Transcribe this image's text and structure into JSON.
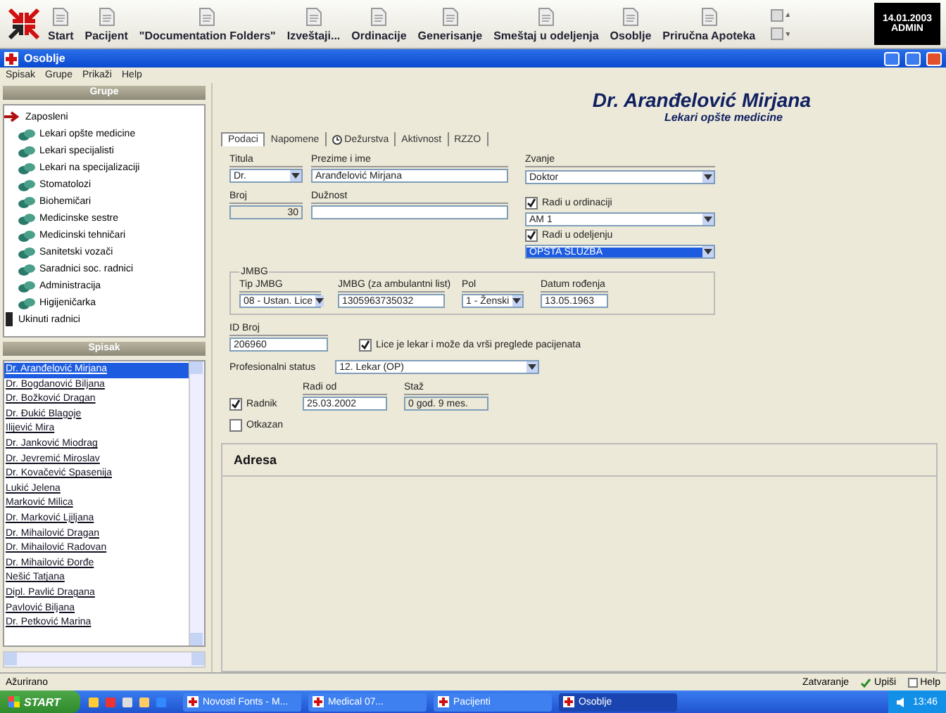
{
  "toolbar": {
    "buttons": [
      {
        "label": "Start"
      },
      {
        "label": "Pacijent"
      },
      {
        "label": "\"Documentation Folders\""
      },
      {
        "label": "Izveštaji..."
      },
      {
        "label": "Ordinacije"
      },
      {
        "label": "Generisanje"
      },
      {
        "label": "Smeštaj u odeljenja"
      },
      {
        "label": "Osoblje"
      },
      {
        "label": "Priručna Apoteka"
      }
    ],
    "clock": {
      "date": "14.01.2003",
      "user": "ADMIN"
    }
  },
  "window": {
    "title": "Osoblje"
  },
  "menu": [
    "Spisak",
    "Grupe",
    "Prikaži",
    "Help"
  ],
  "groups": {
    "title": "Grupe",
    "tree": [
      {
        "label": "Zaposleni",
        "kind": "employees",
        "children": [
          {
            "label": "Lekari opšte medicine",
            "kind": "staff"
          },
          {
            "label": "Lekari specijalisti",
            "kind": "staff"
          },
          {
            "label": "Lekari na specijalizaciji",
            "kind": "staff"
          },
          {
            "label": "Stomatolozi",
            "kind": "staff"
          },
          {
            "label": "Biohemičari",
            "kind": "staff"
          },
          {
            "label": "Medicinske sestre",
            "kind": "staff"
          },
          {
            "label": "Medicinski tehničari",
            "kind": "staff"
          },
          {
            "label": "Sanitetski vozači",
            "kind": "staff"
          },
          {
            "label": "Saradnici soc. radnici",
            "kind": "staff"
          },
          {
            "label": "Administracija",
            "kind": "staff"
          },
          {
            "label": "Higijeničarka",
            "kind": "staff"
          }
        ]
      },
      {
        "label": "Ukinuti radnici",
        "kind": "former"
      }
    ]
  },
  "list": {
    "title": "Spisak",
    "items": [
      {
        "name": "Dr. Aranđelović Mirjana",
        "selected": true
      },
      {
        "name": "Dr. Bogdanović Biljana",
        "selected": false
      },
      {
        "name": "Dr. Božković Dragan",
        "selected": false
      },
      {
        "name": "Dr. Đukić Blagoje",
        "selected": false
      },
      {
        "name": "Ilijević Mira",
        "selected": false
      },
      {
        "name": "Dr. Janković Miodrag",
        "selected": false
      },
      {
        "name": "Dr. Jevremić Miroslav",
        "selected": false
      },
      {
        "name": "Dr. Kovačević Spasenija",
        "selected": false
      },
      {
        "name": "Lukić Jelena",
        "selected": false
      },
      {
        "name": "Marković Milica",
        "selected": false
      },
      {
        "name": "Dr. Marković Ljiljana",
        "selected": false
      },
      {
        "name": "Dr. Mihailović Dragan",
        "selected": false
      },
      {
        "name": "Dr. Mihailović Radovan",
        "selected": false
      },
      {
        "name": "Dr. Mihailović Đorđe",
        "selected": false
      },
      {
        "name": "Nešić Tatjana",
        "selected": false
      },
      {
        "name": "Dipl. Pavlić Dragana",
        "selected": false
      },
      {
        "name": "Pavlović Biljana",
        "selected": false
      },
      {
        "name": "Dr. Petković Marina",
        "selected": false
      }
    ]
  },
  "detail": {
    "name": "Dr. Aranđelović Mirjana",
    "group": "Lekari opšte medicine",
    "tabs": [
      {
        "label": "Podaci",
        "selected": true
      },
      {
        "label": "Napomene",
        "selected": false
      },
      {
        "label": "Dežurstva",
        "selected": false
      },
      {
        "label": "Aktivnost",
        "selected": false
      },
      {
        "label": "RZZO",
        "selected": false
      }
    ],
    "titula": {
      "label": "Titula",
      "value": "Dr."
    },
    "prezime": {
      "label": "Prezime i ime",
      "value": "Aranđelović Mirjana"
    },
    "zvanje": {
      "label": "Zvanje",
      "value": "Doktor"
    },
    "broj": {
      "label": "Broj",
      "value": "30"
    },
    "duznost": {
      "label": "Dužnost"
    },
    "ordinacija": {
      "label": "Radi u ordinaciji",
      "checked": true,
      "value": "AM 1",
      "focused": false
    },
    "odeljenje": {
      "label": "Radi u odeljenju",
      "checked": true,
      "value": "OPŠTA SLUŽBA",
      "focused": true
    },
    "jmbg": {
      "title": "JMBG",
      "fields": [
        {
          "label": "Tip JMBG",
          "value": "08 - Ustan. Lice",
          "kind": "select"
        },
        {
          "label": "JMBG (za ambulantni list)",
          "value": "1305963735032",
          "kind": "text"
        },
        {
          "label": "Pol",
          "value": "1 - Ženski",
          "kind": "select"
        },
        {
          "label": "Datum rođenja",
          "value": "13.05.1963",
          "kind": "text"
        }
      ]
    },
    "id_broj": {
      "label": "ID Broj",
      "value": "206960"
    },
    "lekar": {
      "label": "Lice je lekar i može da vrši preglede pacijenata",
      "checked": true
    },
    "status": {
      "label": "Profesionalni status",
      "value": "12. Lekar (OP)"
    },
    "radnik": {
      "label": "Radnik",
      "checked": true
    },
    "radi_od": {
      "label": "Radi od",
      "value": "25.03.2002"
    },
    "staz": {
      "label": "Staž",
      "value": "0 god. 9 mes."
    },
    "otkazan": {
      "label": "Otkazan",
      "checked": false
    },
    "adresa": {
      "title": "Adresa"
    }
  },
  "status_bar": {
    "text": "Ažurirano",
    "buttons": [
      {
        "label": "Zatvaranje"
      },
      {
        "label": "Upiši"
      },
      {
        "label": "Help"
      }
    ]
  },
  "taskbar": {
    "start": "START",
    "tasks": [
      {
        "label": "Novosti Fonts - M...",
        "selected": false
      },
      {
        "label": "Medical 07...",
        "selected": false
      },
      {
        "label": "Pacijenti",
        "selected": false
      },
      {
        "label": "Osoblje",
        "selected": true
      }
    ],
    "time": "13:46"
  }
}
